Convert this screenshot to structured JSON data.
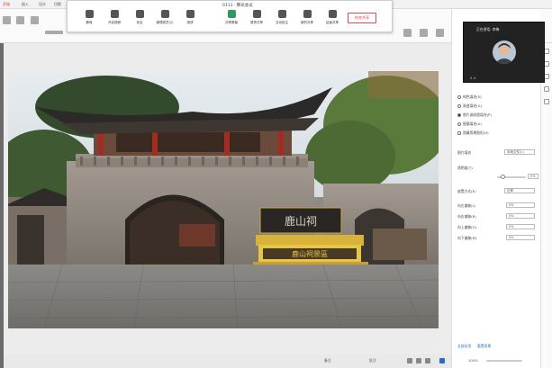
{
  "app": {
    "tabs": [
      "开始",
      "插入",
      "设计",
      "切换"
    ]
  },
  "meeting": {
    "title": "0111 · 腾讯会议",
    "buttons": [
      {
        "label": "静音",
        "icon": "microphone-icon"
      },
      {
        "label": "开启视频",
        "icon": "video-camera-icon"
      },
      {
        "label": "安全",
        "icon": "shield-icon"
      },
      {
        "label": "管理成员(2)",
        "icon": "members-icon"
      },
      {
        "label": "邀请",
        "icon": "invite-icon"
      },
      {
        "label": "共享屏幕",
        "icon": "share-screen-icon"
      },
      {
        "label": "暂停共享",
        "icon": "pause-share-icon"
      },
      {
        "label": "互动批注",
        "icon": "annotate-icon"
      },
      {
        "label": "新的共享",
        "icon": "new-share-icon"
      },
      {
        "label": "结束共享",
        "icon": "stop-share-icon"
      }
    ],
    "end_label": "结束共享"
  },
  "video": {
    "name": "正在讲话: 李梅",
    "count": "2 人"
  },
  "panel": {
    "options": [
      {
        "label": "纯色填充(S)",
        "selected": false
      },
      {
        "label": "渐变填充(G)",
        "selected": false
      },
      {
        "label": "图片或纹理填充(P)",
        "selected": true
      },
      {
        "label": "图案填充(A)",
        "selected": false
      },
      {
        "label": "隐藏背景图形(H)",
        "selected": false
      }
    ],
    "image_source_label": "图片填充",
    "image_source_value": "本地文件(L)",
    "transparency_label": "透明度(T)",
    "transparency_value": "0%",
    "offset_label": "放置方式(E)",
    "offset_value": "拉伸",
    "offsets": [
      {
        "label": "向左偏移(L)",
        "value": "0%"
      },
      {
        "label": "向右偏移(R)",
        "value": "0%"
      },
      {
        "label": "向上偏移(O)",
        "value": "0%"
      },
      {
        "label": "向下偏移(M)",
        "value": "0%"
      }
    ],
    "apply_all": "全部应用",
    "reset": "重置背景"
  },
  "sign": {
    "top": "鹿山祠",
    "bottom": "鹿山祠景區"
  },
  "status": {
    "notes": "备注",
    "comments": "批注",
    "zoom": "100%"
  }
}
